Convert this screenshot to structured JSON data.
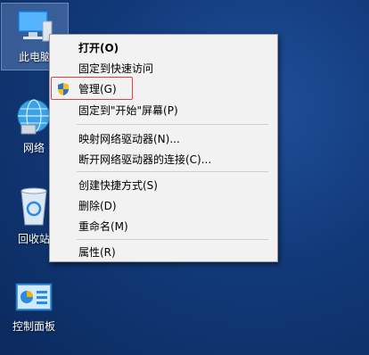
{
  "desktop": {
    "icons": [
      {
        "label": "此电脑"
      },
      {
        "label": "网络"
      },
      {
        "label": "回收站"
      },
      {
        "label": "控制面板"
      }
    ]
  },
  "context_menu": {
    "items": [
      {
        "label": "打开(O)"
      },
      {
        "label": "固定到快速访问"
      },
      {
        "label": "管理(G)"
      },
      {
        "label": "固定到\"开始\"屏幕(P)"
      },
      {
        "label": "映射网络驱动器(N)..."
      },
      {
        "label": "断开网络驱动器的连接(C)..."
      },
      {
        "label": "创建快捷方式(S)"
      },
      {
        "label": "删除(D)"
      },
      {
        "label": "重命名(M)"
      },
      {
        "label": "属性(R)"
      }
    ]
  },
  "colors": {
    "highlight_border": "#e04040",
    "menu_background": "#f2f2f2"
  }
}
